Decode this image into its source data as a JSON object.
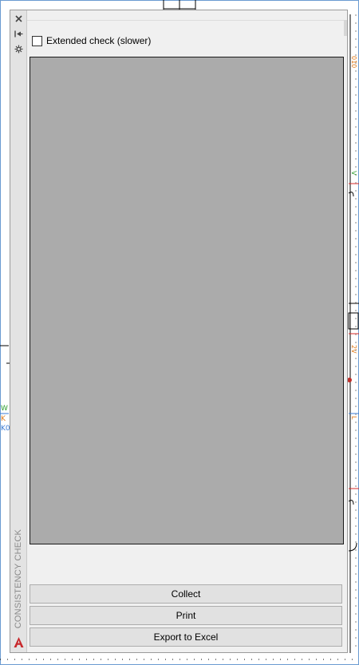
{
  "palette": {
    "title": "CONSISTENCY CHECK",
    "extended_check_label": "Extended check (slower)",
    "extended_check_checked": false,
    "buttons": {
      "collect": "Collect",
      "print": "Print",
      "export": "Export to Excel"
    },
    "icons": {
      "close": "close-icon",
      "autohide": "auto-hide-icon",
      "properties": "properties-icon",
      "logo": "autocad-logo-icon"
    }
  },
  "drawing_labels": {
    "left_w": "W",
    "left_k": "K",
    "left_k0": "K0",
    "right_top": "010",
    "right_mid": "2V",
    "right_v": "V",
    "right_l": "L"
  },
  "colors": {
    "palette_bg": "#f0f0f0",
    "results_bg": "#ababab",
    "button_bg": "#e1e1e1",
    "accent_red": "#d42b2b"
  }
}
